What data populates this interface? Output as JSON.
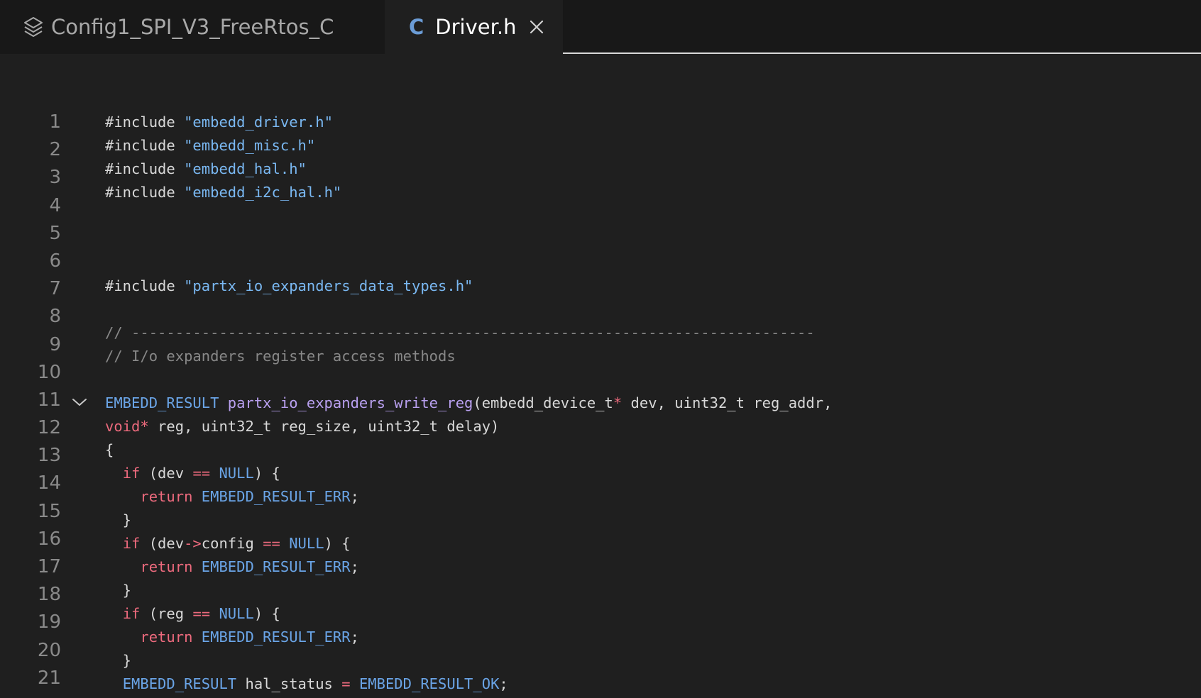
{
  "tabs": {
    "project": {
      "label": "Config1_SPI_V3_FreeRtos_C",
      "icon": "layers-icon"
    },
    "file": {
      "label": "Driver.h",
      "icon_letter": "C",
      "icon": "c-language-icon",
      "close_icon": "close-icon"
    }
  },
  "editor": {
    "line_numbers": [
      "1",
      "2",
      "3",
      "4",
      "5",
      "6",
      "7",
      "8",
      "9",
      "10",
      "11",
      "12",
      "13",
      "14",
      "15",
      "16",
      "17",
      "18",
      "19",
      "20",
      "21"
    ],
    "fold_icon": "chevron-down-icon",
    "lines": [
      [
        {
          "t": "#include ",
          "c": ""
        },
        {
          "t": "\"embedd_driver.h\"",
          "c": "t-str"
        }
      ],
      [
        {
          "t": "#include ",
          "c": ""
        },
        {
          "t": "\"embedd_misc.h\"",
          "c": "t-str"
        }
      ],
      [
        {
          "t": "#include ",
          "c": ""
        },
        {
          "t": "\"embedd_hal.h\"",
          "c": "t-str"
        }
      ],
      [
        {
          "t": "#include ",
          "c": ""
        },
        {
          "t": "\"embedd_i2c_hal.h\"",
          "c": "t-str"
        }
      ],
      [],
      [],
      [],
      [
        {
          "t": "#include ",
          "c": ""
        },
        {
          "t": "\"partx_io_expanders_data_types.h\"",
          "c": "t-str"
        }
      ],
      [],
      [
        {
          "t": "// ------------------------------------------------------------------------------",
          "c": "t-cm"
        }
      ],
      [
        {
          "t": "// I/o expanders register access methods",
          "c": "t-cm"
        }
      ],
      [],
      [
        {
          "t": "EMBEDD_RESULT ",
          "c": "t-mac"
        },
        {
          "t": "partx_io_expanders_write_reg",
          "c": "t-fn"
        },
        {
          "t": "(embedd_device_t",
          "c": ""
        },
        {
          "t": "*",
          "c": "t-op"
        },
        {
          "t": " dev, uint32_t reg_addr,",
          "c": ""
        }
      ],
      [
        {
          "t": "void",
          "c": "t-kw"
        },
        {
          "t": "*",
          "c": "t-op"
        },
        {
          "t": " reg, uint32_t reg_size, uint32_t delay)",
          "c": ""
        }
      ],
      [
        {
          "t": "{",
          "c": ""
        }
      ],
      [
        {
          "t": "  ",
          "c": ""
        },
        {
          "t": "if",
          "c": "t-kw"
        },
        {
          "t": " (dev ",
          "c": ""
        },
        {
          "t": "==",
          "c": "t-op"
        },
        {
          "t": " ",
          "c": ""
        },
        {
          "t": "NULL",
          "c": "t-mac"
        },
        {
          "t": ") {",
          "c": ""
        }
      ],
      [
        {
          "t": "    ",
          "c": ""
        },
        {
          "t": "return",
          "c": "t-kw"
        },
        {
          "t": " ",
          "c": ""
        },
        {
          "t": "EMBEDD_RESULT_ERR",
          "c": "t-mac"
        },
        {
          "t": ";",
          "c": ""
        }
      ],
      [
        {
          "t": "  }",
          "c": ""
        }
      ],
      [
        {
          "t": "  ",
          "c": ""
        },
        {
          "t": "if",
          "c": "t-kw"
        },
        {
          "t": " (dev",
          "c": ""
        },
        {
          "t": "->",
          "c": "t-op"
        },
        {
          "t": "config ",
          "c": ""
        },
        {
          "t": "==",
          "c": "t-op"
        },
        {
          "t": " ",
          "c": ""
        },
        {
          "t": "NULL",
          "c": "t-mac"
        },
        {
          "t": ") {",
          "c": ""
        }
      ],
      [
        {
          "t": "    ",
          "c": ""
        },
        {
          "t": "return",
          "c": "t-kw"
        },
        {
          "t": " ",
          "c": ""
        },
        {
          "t": "EMBEDD_RESULT_ERR",
          "c": "t-mac"
        },
        {
          "t": ";",
          "c": ""
        }
      ],
      [
        {
          "t": "  }",
          "c": ""
        }
      ],
      [
        {
          "t": "  ",
          "c": ""
        },
        {
          "t": "if",
          "c": "t-kw"
        },
        {
          "t": " (reg ",
          "c": ""
        },
        {
          "t": "==",
          "c": "t-op"
        },
        {
          "t": " ",
          "c": ""
        },
        {
          "t": "NULL",
          "c": "t-mac"
        },
        {
          "t": ") {",
          "c": ""
        }
      ],
      [
        {
          "t": "    ",
          "c": ""
        },
        {
          "t": "return",
          "c": "t-kw"
        },
        {
          "t": " ",
          "c": ""
        },
        {
          "t": "EMBEDD_RESULT_ERR",
          "c": "t-mac"
        },
        {
          "t": ";",
          "c": ""
        }
      ],
      [
        {
          "t": "  }",
          "c": ""
        }
      ],
      [
        {
          "t": "  ",
          "c": ""
        },
        {
          "t": "EMBEDD_RESULT",
          "c": "t-mac"
        },
        {
          "t": " hal_status ",
          "c": ""
        },
        {
          "t": "=",
          "c": "t-op"
        },
        {
          "t": " ",
          "c": ""
        },
        {
          "t": "EMBEDD_RESULT_OK",
          "c": "t-mac"
        },
        {
          "t": ";",
          "c": ""
        }
      ]
    ]
  },
  "colors": {
    "background": "#1f1f1f",
    "tabbar": "#181818",
    "string": "#7ab8f2",
    "comment": "#888888",
    "keyword": "#ec6a7d",
    "macro": "#6aa4e6",
    "function": "#b9a0f0"
  }
}
